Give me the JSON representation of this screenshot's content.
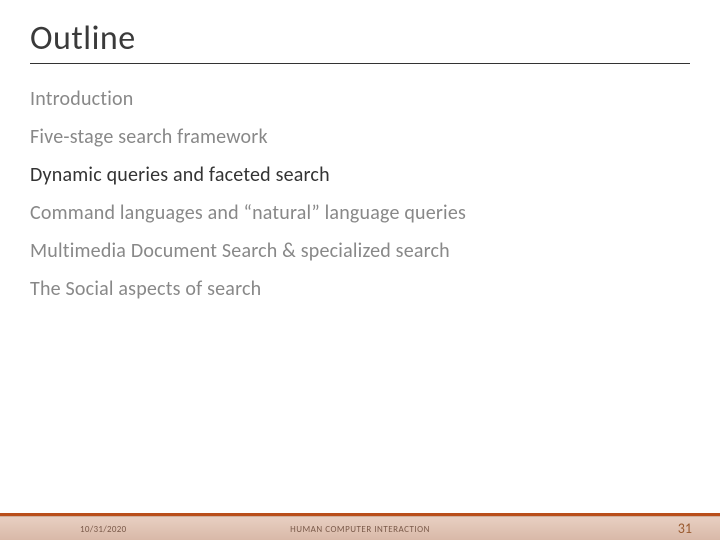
{
  "title": "Outline",
  "items": [
    {
      "label": "Introduction",
      "active": false
    },
    {
      "label": "Five-stage search framework",
      "active": false
    },
    {
      "label": "Dynamic queries and faceted search",
      "active": true
    },
    {
      "label": "Command languages and “natural” language queries",
      "active": false
    },
    {
      "label": "Multimedia Document Search & specialized search",
      "active": false
    },
    {
      "label": "The Social aspects of search",
      "active": false
    }
  ],
  "footer": {
    "date": "10/31/2020",
    "center": "HUMAN COMPUTER INTERACTION",
    "page": "31"
  }
}
